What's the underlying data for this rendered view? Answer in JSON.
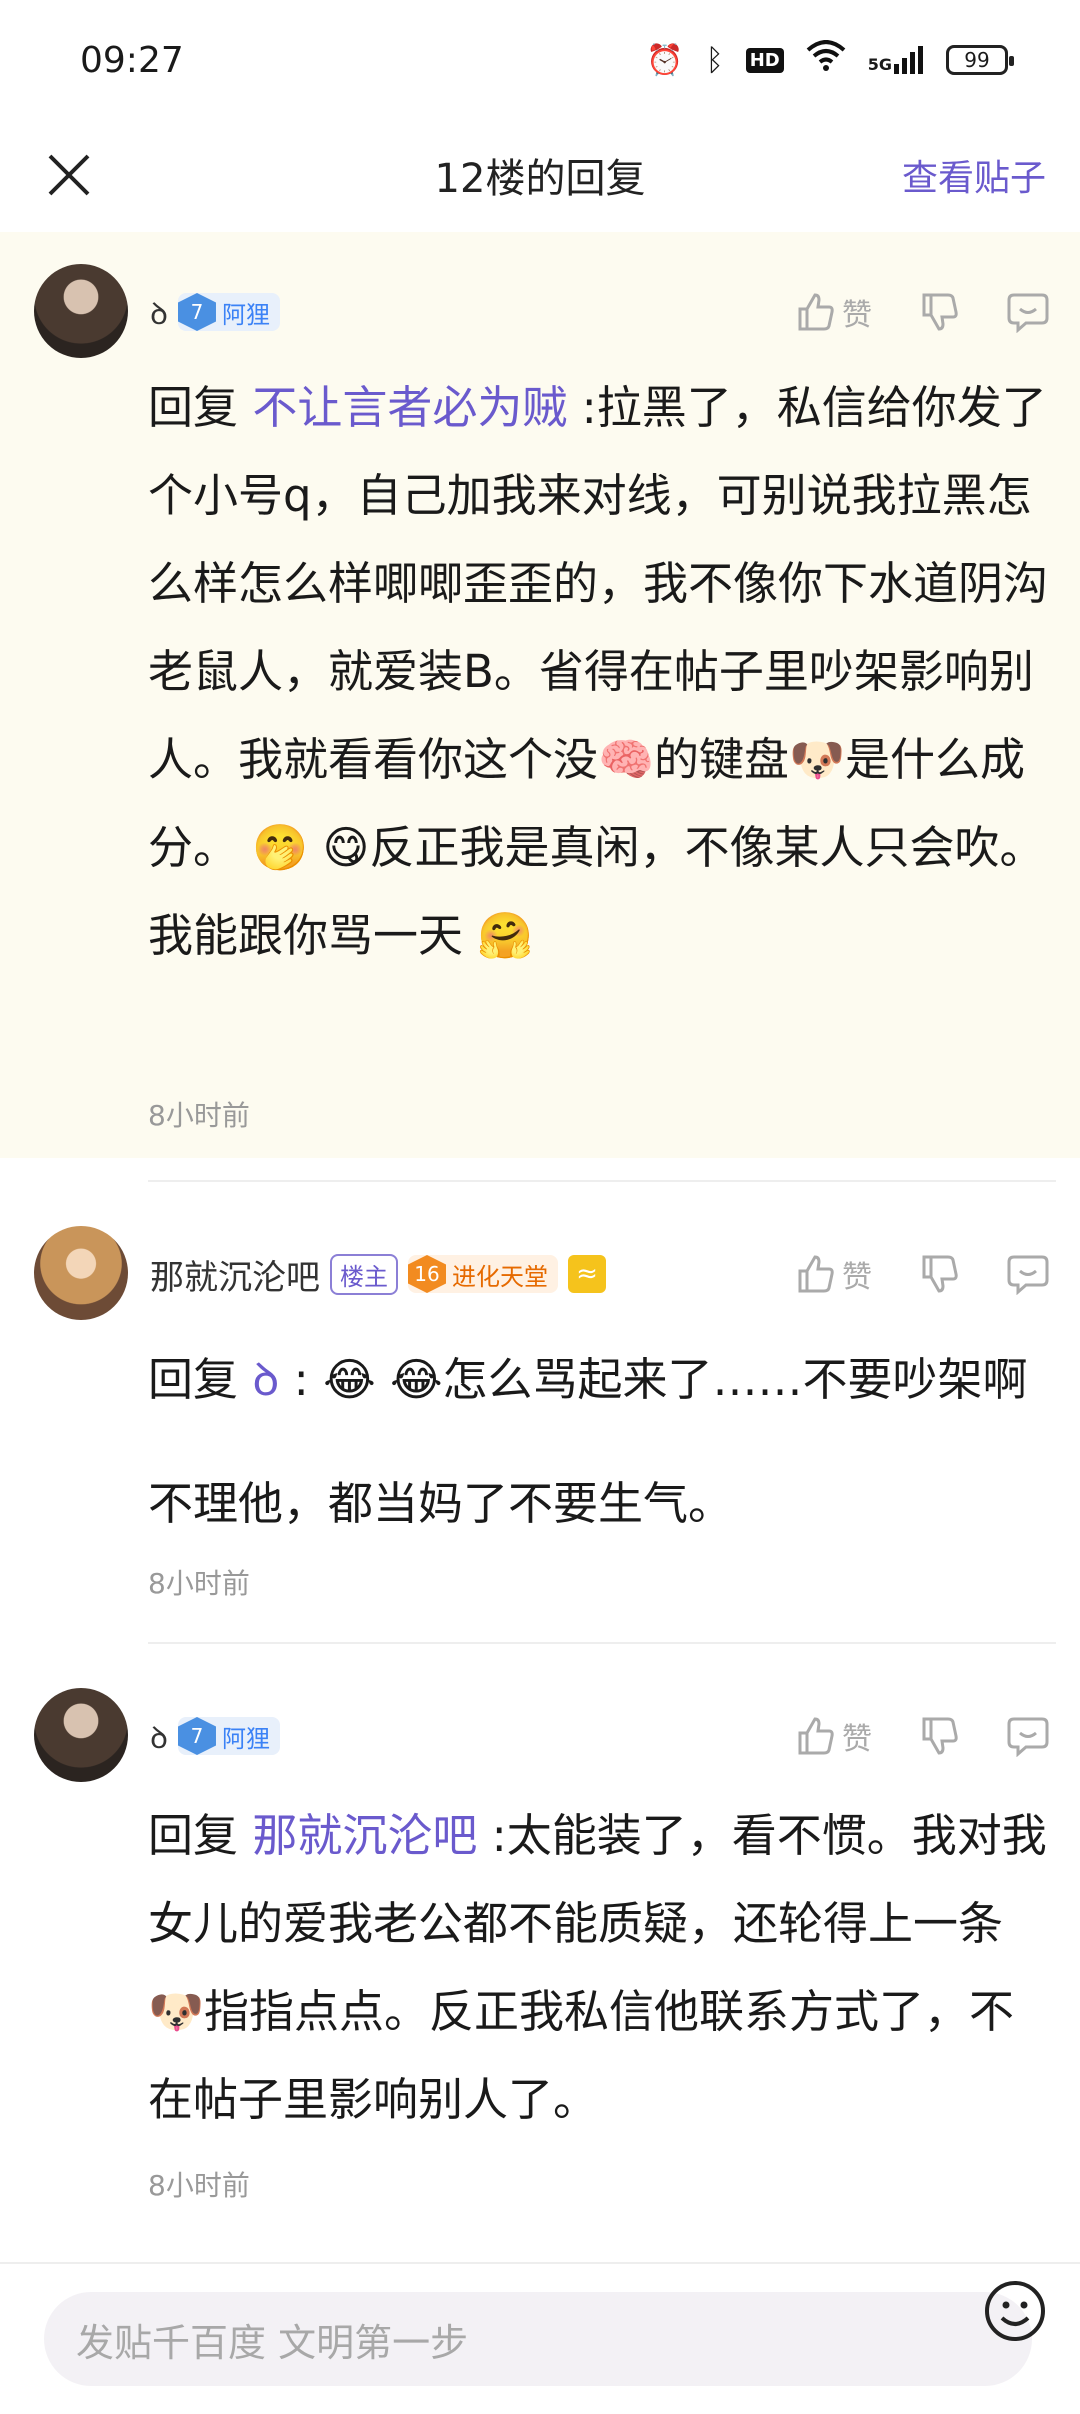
{
  "status_bar": {
    "time": "09:27",
    "hd": "HD",
    "signal": "5G",
    "battery": "99"
  },
  "nav": {
    "title": "12楼的回复",
    "right_link": "查看贴子"
  },
  "replies": [
    {
      "username": "",
      "name_glyph": "ꝺ",
      "level": "7",
      "badge": "阿狸",
      "like_label": "赞",
      "prefix": "回复",
      "mention": "不让言者必为贼",
      "text": "  :拉黑了，私信给你发了个小号q，自己加我来对线，可别说我拉黑怎么样怎么样唧唧歪歪的，我不像你下水道阴沟老鼠人，就爱装B。省得在帖子里吵架影响别人。我就看看你这个没🧠的键盘🐶是什么成分。 🤭 😋反正我是真闲，不像某人只会吹。我能跟你骂一天 🤗",
      "time": "8小时前"
    },
    {
      "username": "那就沉沦吧",
      "owner_badge": "楼主",
      "level": "16",
      "badge": "进化天堂",
      "like_label": "赞",
      "prefix": "回复",
      "mention_glyph": "ꝺ",
      "text": " : 😂 😂怎么骂起来了……不要吵架啊不理他，都当妈了不要生气。",
      "time": "8小时前"
    },
    {
      "username": "",
      "name_glyph": "ꝺ",
      "level": "7",
      "badge": "阿狸",
      "like_label": "赞",
      "prefix": "回复",
      "mention": "那就沉沦吧",
      "text": "  :太能装了，看不惯。我对我女儿的爱我老公都不能质疑，还轮得上一条🐶指指点点。反正我私信他联系方式了，不在帖子里影响别人了。",
      "time": "8小时前"
    }
  ],
  "input": {
    "placeholder": "发贴千百度 文明第一步"
  },
  "colors": {
    "accent": "#6a5acd",
    "highlight_bg": "#fdfbf0",
    "level_blue": "#4a90e2",
    "level_orange": "#f28b20"
  },
  "icons": [
    "close-icon",
    "like-icon",
    "dislike-icon",
    "comment-icon",
    "emoji-icon",
    "alarm-icon",
    "bluetooth-icon",
    "wifi-icon"
  ]
}
